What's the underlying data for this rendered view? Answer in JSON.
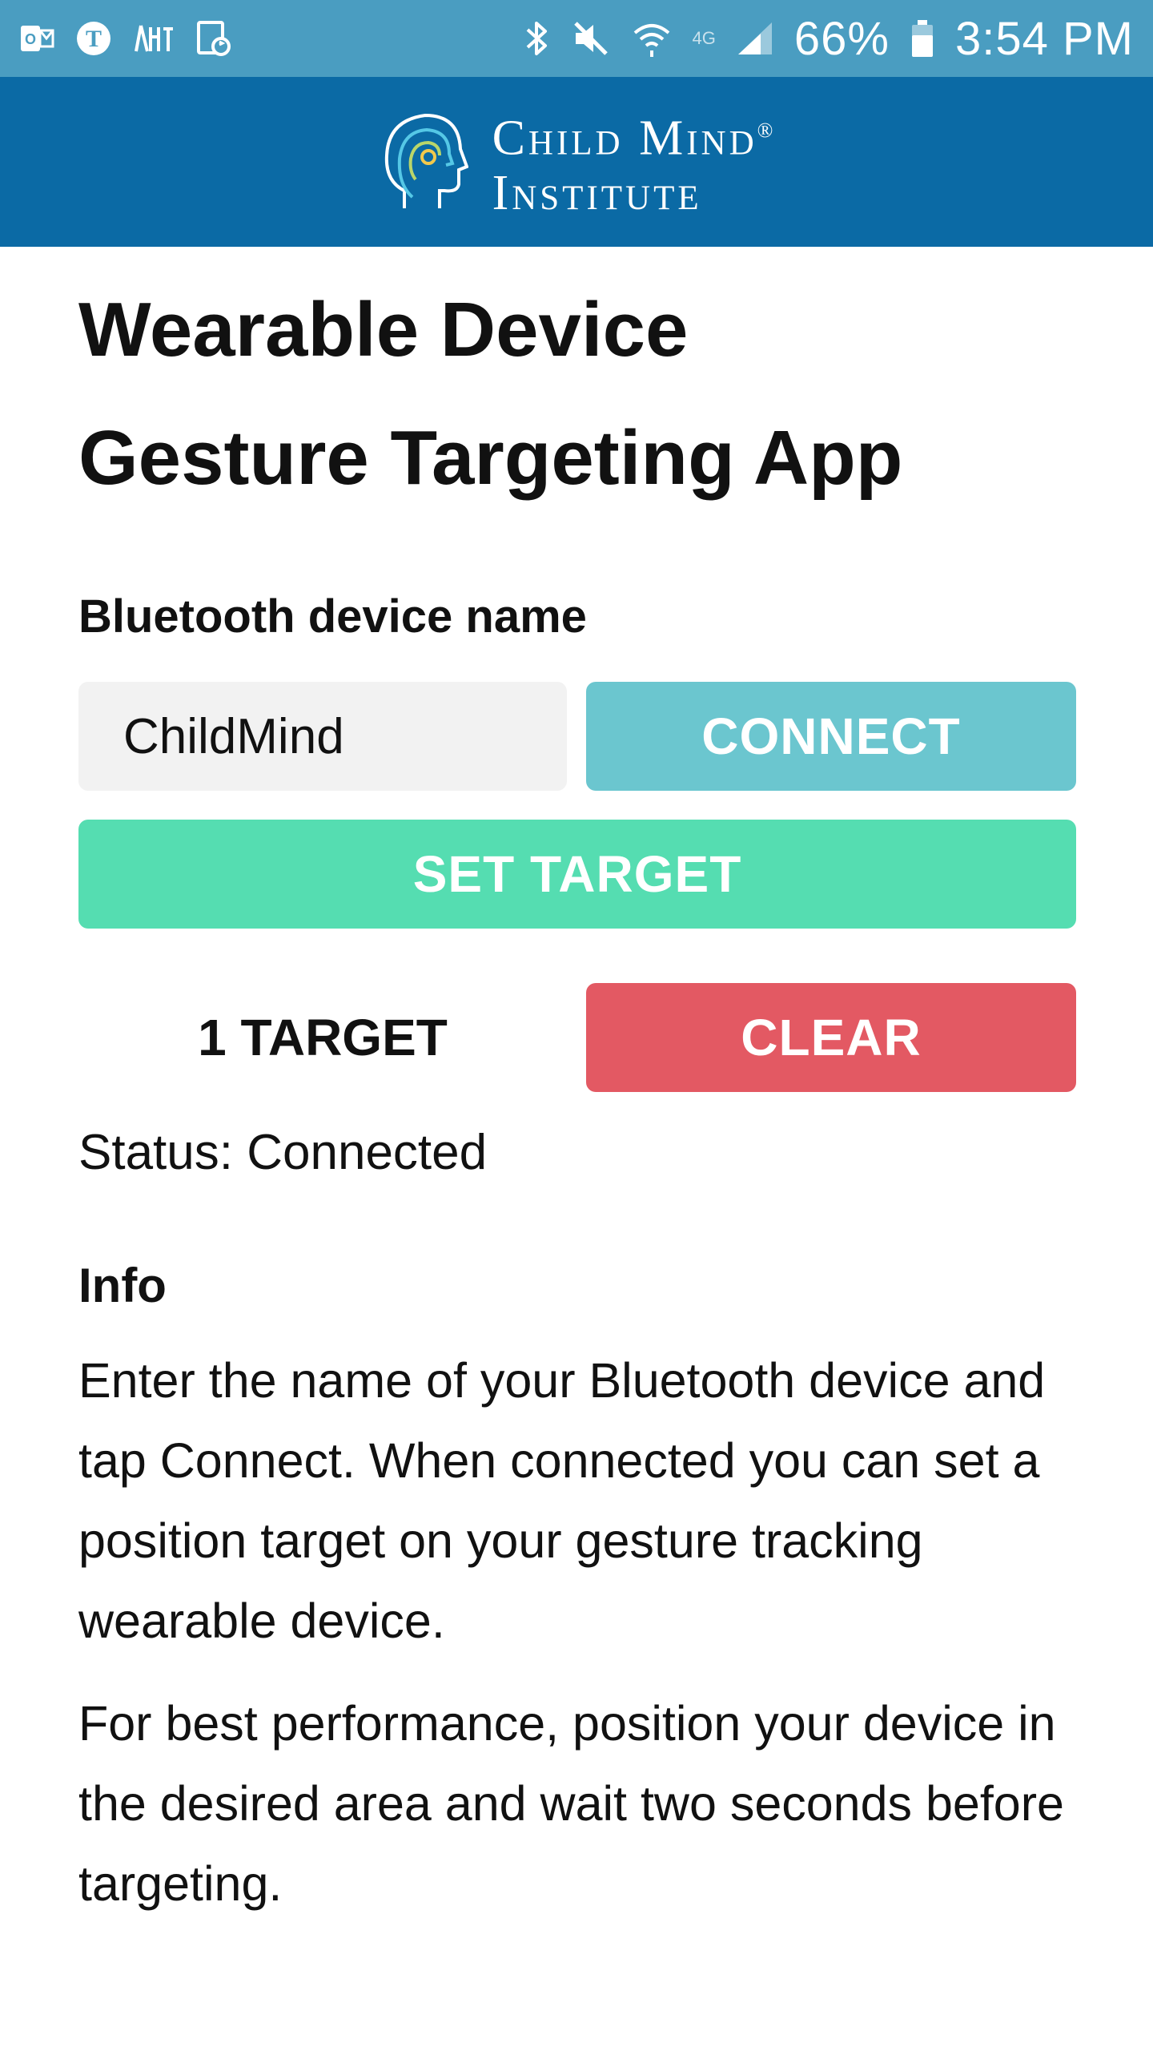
{
  "status_bar": {
    "left_icons": [
      "outlook-icon",
      "nyt-icon",
      "nyt-app-icon",
      "sync-icon"
    ],
    "right_icons": [
      "bluetooth-icon",
      "mute-icon",
      "wifi-icon",
      "lte-icon",
      "signal-icon",
      "battery-icon"
    ],
    "lte_label": "4G",
    "battery_percent": "66%",
    "time": "3:54 PM"
  },
  "header": {
    "logo_line1": "Child Mind",
    "logo_reg": "®",
    "logo_line2": "Institute",
    "colors": {
      "background": "#0b6aa5",
      "status_bar": "#4a9dc1"
    }
  },
  "main": {
    "title_line1": "Wearable Device",
    "title_line2": "Gesture Targeting App",
    "device_label": "Bluetooth device name",
    "device_input_value": "ChildMind",
    "connect_label": "CONNECT",
    "set_target_label": "SET TARGET",
    "target_count": "1 TARGET",
    "clear_label": "CLEAR",
    "status_text": "Status: Connected",
    "info_heading": "Info",
    "info_paragraph1": "Enter the name of your Bluetooth device and tap Connect. When connected you can set a position target on your gesture tracking wearable device.",
    "info_paragraph2": "For best performance, position your device in the desired area and wait two seconds before targeting.",
    "colors": {
      "connect": "#6bc6cf",
      "set_target": "#55ddb1",
      "clear": "#e35963"
    }
  }
}
